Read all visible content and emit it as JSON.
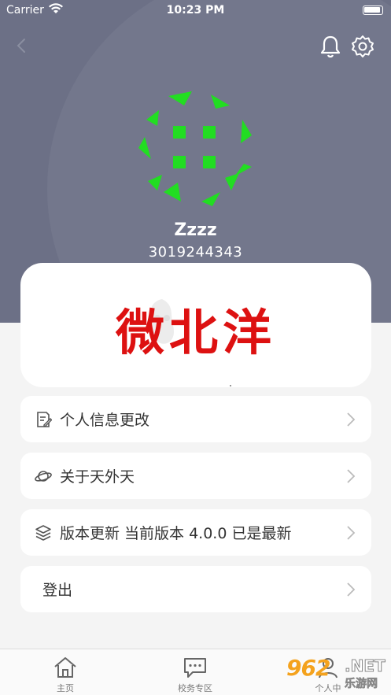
{
  "status_bar": {
    "carrier": "Carrier",
    "time": "10:23 PM"
  },
  "profile": {
    "name": "Zzzz",
    "id": "3019244343"
  },
  "banner": {
    "text": "微北洋"
  },
  "menu": [
    {
      "label": "个人信息更改",
      "icon": "edit-document-icon"
    },
    {
      "label": "关于天外天",
      "icon": "planet-icon"
    },
    {
      "label": "版本更新 当前版本 4.0.0 已是最新",
      "icon": "layers-icon"
    },
    {
      "label": "登出",
      "icon": ""
    }
  ],
  "tabbar": {
    "home": "主页",
    "campus": "校务专区",
    "profile_partial": "个人中"
  },
  "watermark": {
    "number": "962",
    "net": ".NET",
    "cn": "乐游网"
  },
  "colors": {
    "header": "#6c7086",
    "banner_text": "#dd1111",
    "avatar_green": "#22dd22"
  }
}
